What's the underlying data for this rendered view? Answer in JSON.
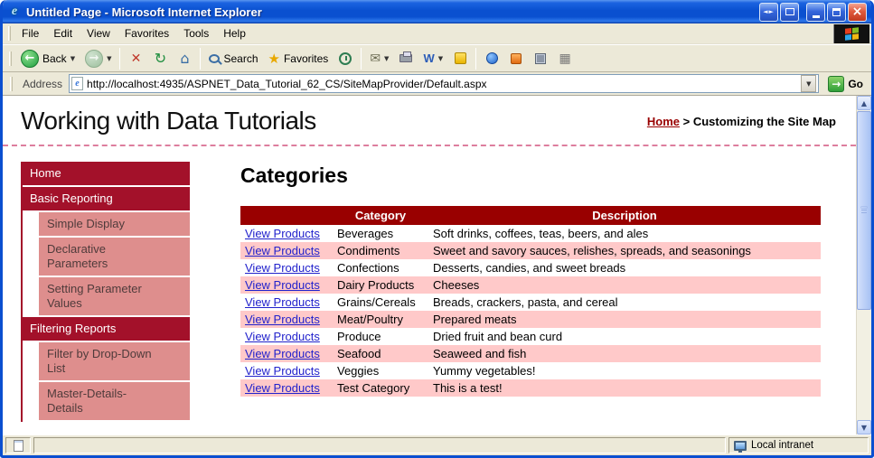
{
  "window": {
    "title": "Untitled Page - Microsoft Internet Explorer"
  },
  "menu": {
    "items": [
      "File",
      "Edit",
      "View",
      "Favorites",
      "Tools",
      "Help"
    ]
  },
  "toolbar": {
    "back": "Back",
    "search": "Search",
    "favorites": "Favorites"
  },
  "address_bar": {
    "label": "Address",
    "url": "http://localhost:4935/ASPNET_Data_Tutorial_62_CS/SiteMapProvider/Default.aspx",
    "go": "Go"
  },
  "page": {
    "title": "Working with Data Tutorials",
    "breadcrumb": {
      "home": "Home",
      "separator": ">",
      "current": "Customizing the Site Map"
    },
    "sidebar": {
      "items": [
        {
          "label": "Home"
        },
        {
          "label": "Basic Reporting"
        },
        {
          "label": "Simple Display"
        },
        {
          "label": "Declarative Parameters"
        },
        {
          "label": "Setting Parameter Values"
        },
        {
          "label": "Filtering Reports"
        },
        {
          "label": "Filter by Drop-Down List"
        },
        {
          "label": "Master-Details-Details"
        }
      ]
    },
    "main": {
      "heading": "Categories",
      "table": {
        "headers": [
          "",
          "Category",
          "Description"
        ],
        "link_label": "View Products",
        "rows": [
          {
            "category": "Beverages",
            "description": "Soft drinks, coffees, teas, beers, and ales"
          },
          {
            "category": "Condiments",
            "description": "Sweet and savory sauces, relishes, spreads, and seasonings"
          },
          {
            "category": "Confections",
            "description": "Desserts, candies, and sweet breads"
          },
          {
            "category": "Dairy Products",
            "description": "Cheeses"
          },
          {
            "category": "Grains/Cereals",
            "description": "Breads, crackers, pasta, and cereal"
          },
          {
            "category": "Meat/Poultry",
            "description": "Prepared meats"
          },
          {
            "category": "Produce",
            "description": "Dried fruit and bean curd"
          },
          {
            "category": "Seafood",
            "description": "Seaweed and fish"
          },
          {
            "category": "Veggies",
            "description": "Yummy vegetables!"
          },
          {
            "category": "Test Category",
            "description": "This is a test!"
          }
        ]
      }
    }
  },
  "status_bar": {
    "zone": "Local intranet"
  },
  "icons": {
    "titlebar_arrows": "◄►",
    "back_arrow": "←",
    "forward_arrow": "→",
    "stop": "✕",
    "refresh": "↻",
    "home": "⌂",
    "star": "★",
    "mail": "✉",
    "edit": "W",
    "grid": "▦",
    "dropdown": "▼",
    "go_arrow": "→",
    "close": "×",
    "up_arrow": "▲",
    "down_arrow": "▼"
  },
  "colors": {
    "maroon": "#990000",
    "sidebar_dark": "#A3112A",
    "sidebar_light": "#DE8E8D",
    "row_pink": "#FFC9C9",
    "link_blue": "#2222CC",
    "divider_pink": "#DD7E9E"
  }
}
